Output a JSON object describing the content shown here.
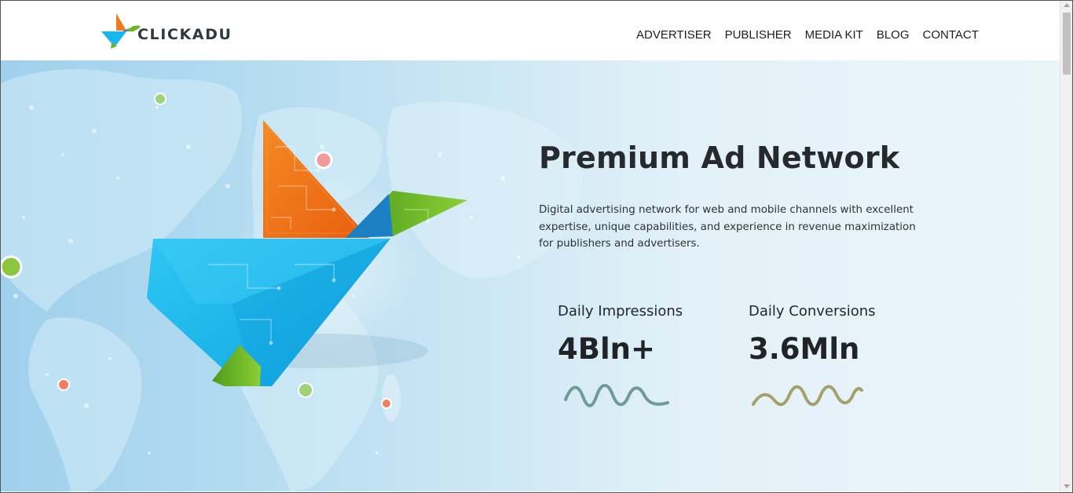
{
  "brand": {
    "name": "CLICKADU",
    "colors": {
      "orange": "#f07a1e",
      "blue": "#19b6ea",
      "green": "#6cb42c",
      "dark": "#2f3a40"
    }
  },
  "nav": {
    "items": [
      {
        "label": "ADVERTISER"
      },
      {
        "label": "PUBLISHER"
      },
      {
        "label": "MEDIA KIT"
      },
      {
        "label": "BLOG"
      },
      {
        "label": "CONTACT"
      }
    ]
  },
  "hero": {
    "title": "Premium Ad Network",
    "description": "Digital advertising network for web and mobile channels with excellent expertise, unique capabilities, and experience in revenue maximization for publishers and advertisers.",
    "stats": [
      {
        "label": "Daily Impressions",
        "value": "4Bln+",
        "wave_color": "#6e9a9a"
      },
      {
        "label": "Daily Conversions",
        "value": "3.6Mln",
        "wave_color": "#a6a06a"
      }
    ]
  }
}
